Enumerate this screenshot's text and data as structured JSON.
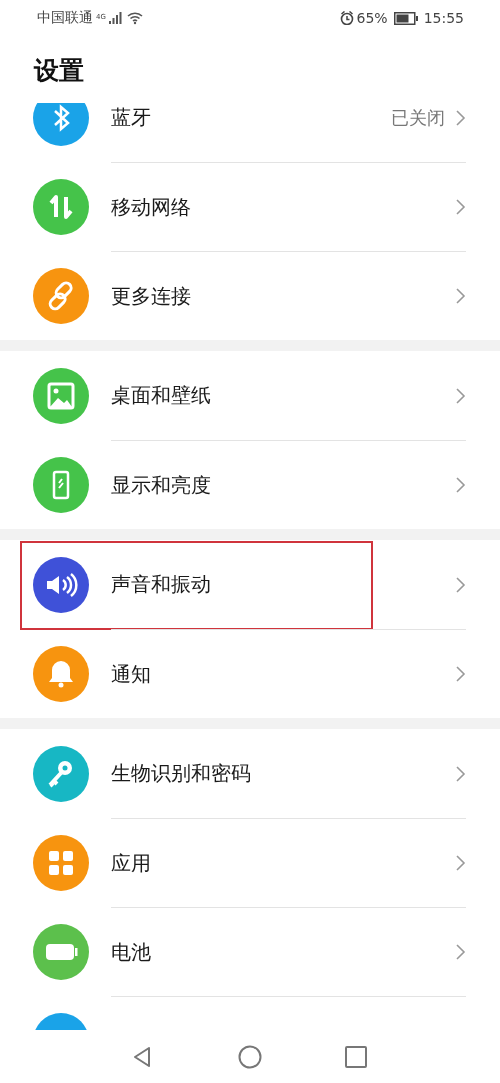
{
  "status_bar": {
    "carrier": "中国联通",
    "network": "4G",
    "battery": "65%",
    "time": "15:55"
  },
  "title": "设置",
  "groups": [
    {
      "items": [
        {
          "color": "#1aa3e8",
          "label": "蓝牙",
          "value": "已关闭"
        },
        {
          "color": "#45c34a",
          "label": "移动网络"
        },
        {
          "color": "#f7940f",
          "label": "更多连接"
        }
      ]
    },
    {
      "items": [
        {
          "color": "#45c34a",
          "label": "桌面和壁纸"
        },
        {
          "color": "#45c34a",
          "label": "显示和亮度"
        }
      ]
    },
    {
      "items": [
        {
          "color": "#3f51d8",
          "label": "声音和振动",
          "highlighted": true
        },
        {
          "color": "#f7940f",
          "label": "通知",
          "highlighted": false
        }
      ]
    },
    {
      "items": [
        {
          "color": "#17b7c4",
          "label": "生物识别和密码"
        },
        {
          "color": "#f7940f",
          "label": "应用"
        },
        {
          "color": "#5cc04c",
          "label": "电池"
        },
        {
          "color": "#1aa3e8"
        }
      ]
    }
  ]
}
